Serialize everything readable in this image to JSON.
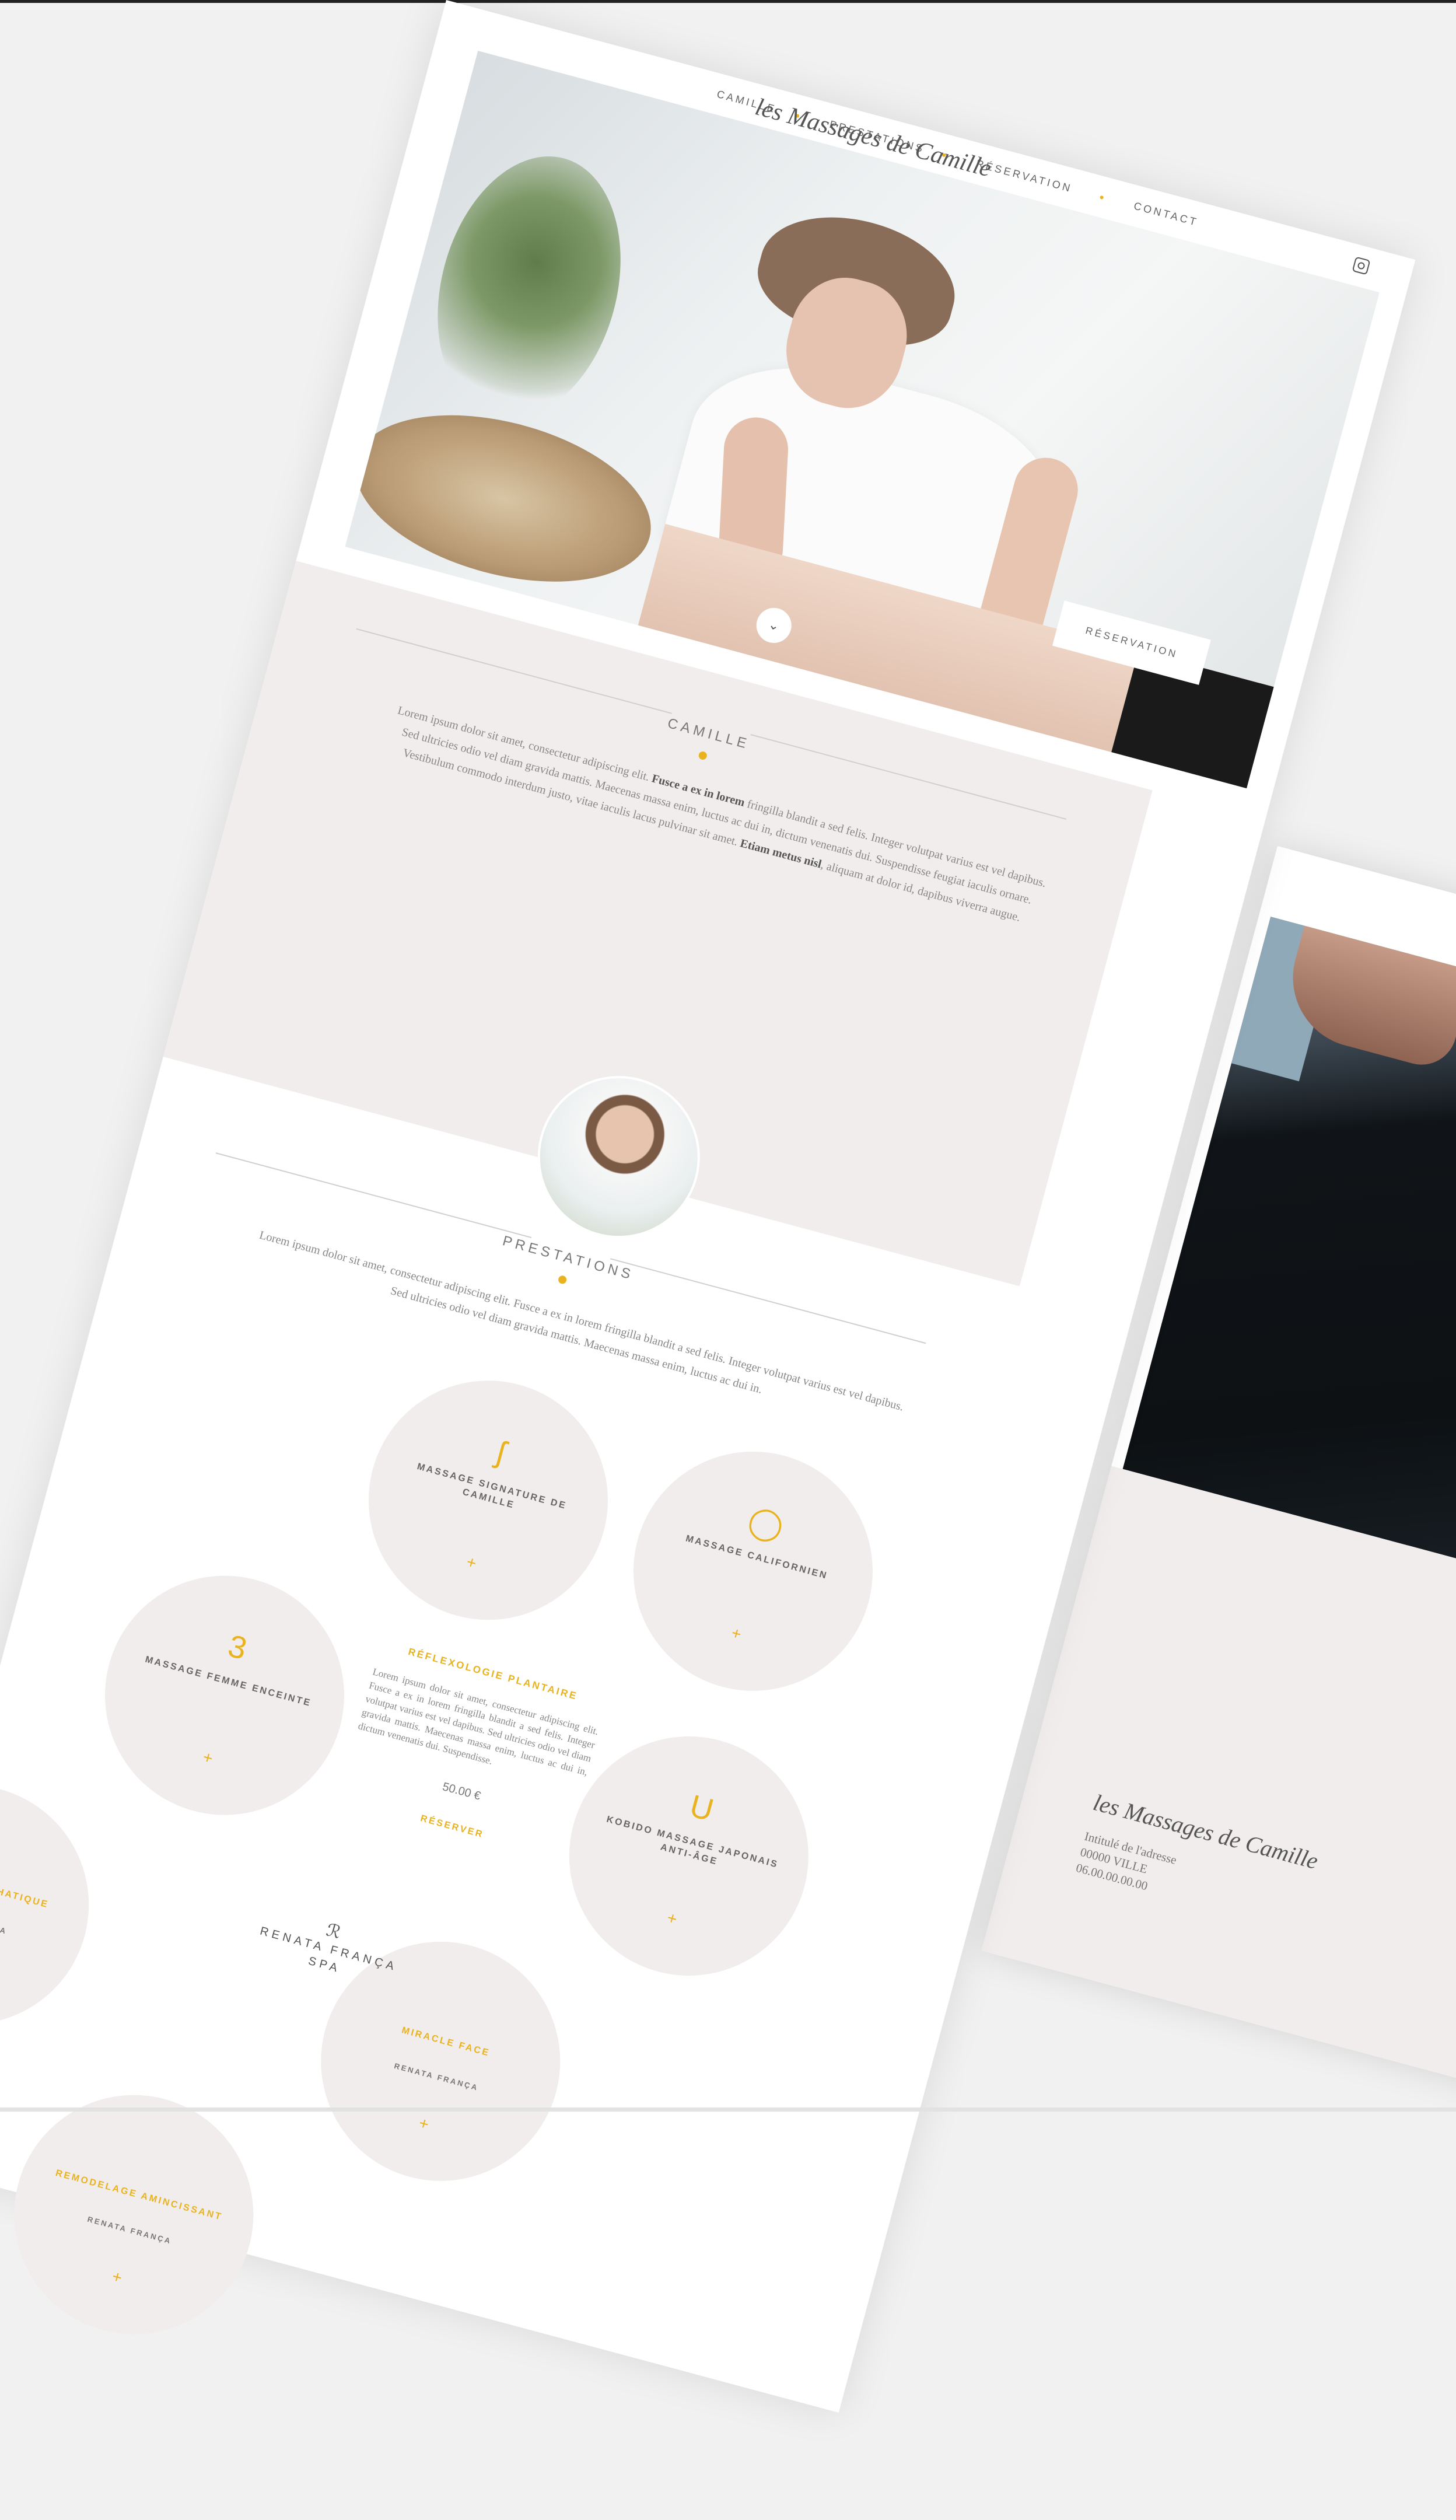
{
  "header": {
    "logo": "les Massages de Camille",
    "nav": [
      "CAMILLE",
      "PRESTATIONS",
      "RÉSERVATION",
      "CONTACT"
    ],
    "icons": [
      "instagram-icon"
    ],
    "reserve_button": "RÉSERVATION",
    "scroll_icon": "chevron-down-icon"
  },
  "about": {
    "title": "CAMILLE",
    "text_1": "Lorem ipsum dolor sit amet, consectetur adipiscing elit. ",
    "bold_1": "Fusce a ex in lorem",
    "text_2": " fringilla blandit a sed felis. Integer volutpat varius est vel dapibus. Sed ultricies odio vel diam gravida mattis. Maecenas massa enim, luctus ac dui in, dictum venenatis dui. Suspendisse feugiat iaculis ornare. Vestibulum commodo interdum justo, vitae iaculis lacus pulvinar sit amet. ",
    "bold_2": "Etiam metus nisl",
    "text_3": ", aliquam at dolor id, dapibus viverra augue."
  },
  "services_section": {
    "title": "PRESTATIONS",
    "text": "Lorem ipsum dolor sit amet, consectetur adipiscing elit. Fusce a ex in lorem fringilla blandit a sed felis. Integer volutpat varius est vel dapibus. Sed ultricies odio vel diam gravida mattis. Maecenas massa enim, luctus ac dui in."
  },
  "services": [
    {
      "name": "MASSAGE SIGNATURE DE CAMILLE",
      "icon": "wave-icon",
      "glyph": "ʃ"
    },
    {
      "name": "MASSAGE CALIFORNIEN",
      "icon": "drop-icon",
      "glyph": "◯"
    },
    {
      "name": "MASSAGE FEMME ENCEINTE",
      "icon": "belly-icon",
      "glyph": "3"
    },
    {
      "name": "KOBIDO MASSAGE JAPONAIS ANTI-ÂGE",
      "icon": "face-outline-icon",
      "glyph": "U"
    },
    {
      "name": "DRAINAGE LYMPHATIQUE",
      "sub": "RENATA FRANÇA"
    },
    {
      "name": "MIRACLE FACE",
      "sub": "RENATA FRANÇA"
    },
    {
      "name": "REMODELAGE AMINCISSANT",
      "sub": "RENATA FRANÇA"
    }
  ],
  "plus_label": "+",
  "detail": {
    "title": "RÉFLEXOLOGIE PLANTAIRE",
    "text": "Lorem ipsum dolor sit amet, consectetur adipiscing elit. Fusce a ex in lorem fringilla blandit a sed felis. Integer volutpat varius est vel dapibus. Sed ultricies odio vel diam gravida mattis. Maecenas massa enim, luctus ac dui in, dictum venenatis dui. Suspendisse.",
    "price": "50.00 €",
    "book": "RÉSERVER"
  },
  "spa": {
    "icon": "renata-franca-logo-icon",
    "glyph": "ℛ",
    "name": "RENATA FRANÇA SPA"
  },
  "footer": {
    "brand": "les Massages de Camille",
    "address": "Intitulé de l'adresse",
    "city": "00000 VILLE",
    "phone": "06.00.00.00.00"
  },
  "colors": {
    "accent": "#e9b31f",
    "beige": "#f2eded",
    "text": "#666666"
  }
}
